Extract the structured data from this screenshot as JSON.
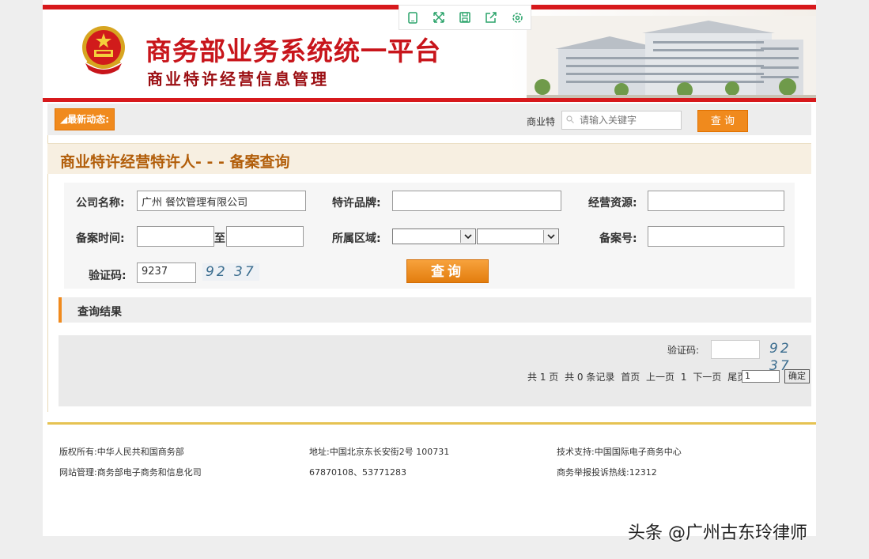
{
  "header": {
    "title": "商务部业务系统统一平台",
    "subtitle": "商业特许经营信息管理"
  },
  "toolbar": {
    "icons": [
      "mobile-icon",
      "fullscreen-icon",
      "save-icon",
      "share-icon",
      "settings-icon"
    ]
  },
  "newsbar": {
    "tag": "最新动态:",
    "search_label": "商业特",
    "search_placeholder": "请输入关键字",
    "search_button": "查 询"
  },
  "section": {
    "title": "商业特许经营特许人- - - 备案查询"
  },
  "form": {
    "company_label": "公司名称:",
    "company_value": "广州      餐饮管理有限公司",
    "brand_label": "特许品牌:",
    "brand_value": "",
    "resource_label": "经营资源:",
    "resource_value": "",
    "record_time_label": "备案时间:",
    "record_time_from": "",
    "record_time_to_label": "至",
    "record_time_to": "",
    "region_label": "所属区域:",
    "record_no_label": "备案号:",
    "record_no_value": "",
    "captcha_label": "验证码:",
    "captcha_value": "9237",
    "captcha_image_text": "92 37",
    "query_button": "查询"
  },
  "results": {
    "title": "查询结果",
    "captcha_label": "验证码:",
    "captcha_image_text": "92 37",
    "pager": {
      "total_pages": "共 1 页",
      "total_records": "共 0 条记录",
      "first": "首页",
      "prev": "上一页",
      "current": "1",
      "next": "下一页",
      "last": "尾页",
      "jump_value": "1",
      "confirm": "确定"
    }
  },
  "footer": {
    "copyright": "版权所有:中华人民共和国商务部",
    "address": "地址:中国北京东长安街2号 100731",
    "tech_support": "技术支持:中国国际电子商务中心",
    "site_admin": "网站管理:商务部电子商务和信息化司",
    "phones": "67870108、53771283",
    "hotline": "商务举报投诉热线:12312"
  },
  "watermark": "头条 @广州古东玲律师",
  "colors": {
    "brand_red": "#d7191c",
    "accent_orange": "#f08a1d",
    "title_brown": "#b25e0a",
    "gold": "#e6c252"
  }
}
